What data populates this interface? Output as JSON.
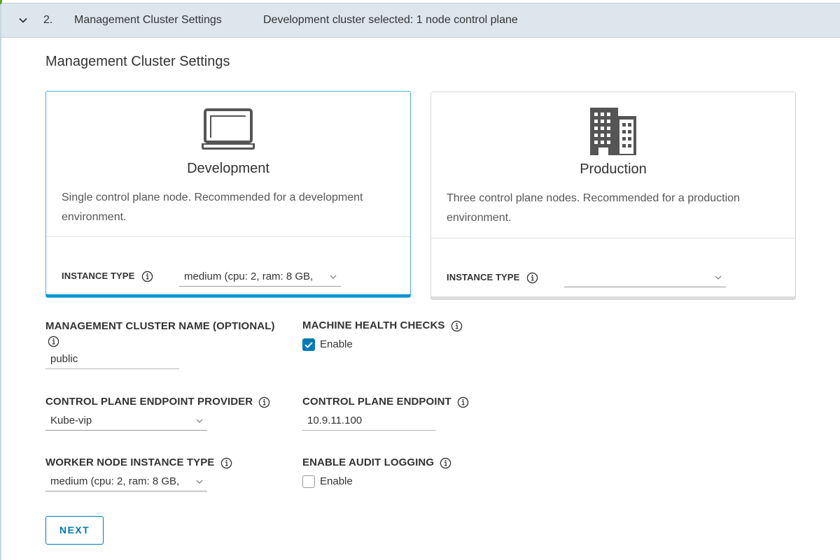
{
  "step": {
    "number": "2.",
    "title": "Management Cluster Settings",
    "summary": "Development cluster selected: 1 node control plane"
  },
  "section_title": "Management Cluster Settings",
  "cards": {
    "development": {
      "title": "Development",
      "description": "Single control plane node. Recommended for a development environment.",
      "instance_type_label": "INSTANCE TYPE",
      "instance_type_value": "medium (cpu: 2, ram: 8 GB,",
      "icon": "laptop-icon",
      "selected": true
    },
    "production": {
      "title": "Production",
      "description": "Three control plane nodes. Recommended for a production environment.",
      "instance_type_label": "INSTANCE TYPE",
      "instance_type_value": "",
      "icon": "building-icon",
      "selected": false
    }
  },
  "form": {
    "cluster_name": {
      "label": "MANAGEMENT CLUSTER NAME (OPTIONAL)",
      "value": "public"
    },
    "machine_health_checks": {
      "label": "MACHINE HEALTH CHECKS",
      "option": "Enable",
      "checked": true
    },
    "endpoint_provider": {
      "label": "CONTROL PLANE ENDPOINT PROVIDER",
      "value": "Kube-vip"
    },
    "endpoint": {
      "label": "CONTROL PLANE ENDPOINT",
      "value": "10.9.11.100"
    },
    "worker_instance_type": {
      "label": "WORKER NODE INSTANCE TYPE",
      "value": "medium (cpu: 2, ram: 8 GB,"
    },
    "audit_logging": {
      "label": "ENABLE AUDIT LOGGING",
      "option": "Enable",
      "checked": false
    }
  },
  "next_button": "NEXT",
  "colors": {
    "accent": "#0079b8",
    "selected_border": "#49afd9",
    "header_bg": "#dde6ed"
  }
}
